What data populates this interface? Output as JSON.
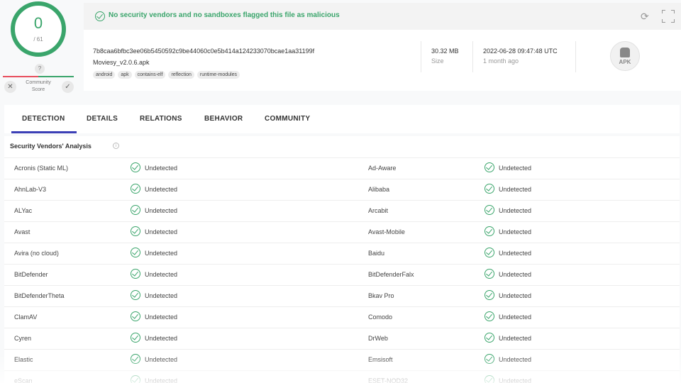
{
  "score": {
    "detections": "0",
    "total": "/ 61",
    "unknown_icon": "?",
    "community_label": "Community Score",
    "ring_color": "#3aa56b"
  },
  "banner": {
    "message": "No security vendors and no sandboxes flagged this file as malicious",
    "accent_color": "#3aa56b",
    "icons": [
      "check-circle-icon",
      "refresh-icon",
      "expand-icon"
    ]
  },
  "file": {
    "hash": "7b8caa6bfbc3ee06b5450592c9be44060c0e5b414a124233070bcae1aa31199f",
    "name": "Moviesy_v2.0.6.apk",
    "tags": [
      "android",
      "apk",
      "contains-elf",
      "reflection",
      "runtime-modules"
    ],
    "size_value": "30.32 MB",
    "size_label": "Size",
    "date_value": "2022-06-28 09:47:48 UTC",
    "date_label": "1 month ago",
    "type_badge": "APK"
  },
  "tabs": [
    {
      "label": "DETECTION",
      "active": true
    },
    {
      "label": "DETAILS",
      "active": false
    },
    {
      "label": "RELATIONS",
      "active": false
    },
    {
      "label": "BEHAVIOR",
      "active": false
    },
    {
      "label": "COMMUNITY",
      "active": false
    }
  ],
  "vendors": {
    "title": "Security Vendors' Analysis",
    "rows": [
      {
        "left": "Acronis (Static ML)",
        "left_status": "Undetected",
        "right": "Ad-Aware",
        "right_status": "Undetected"
      },
      {
        "left": "AhnLab-V3",
        "left_status": "Undetected",
        "right": "Alibaba",
        "right_status": "Undetected"
      },
      {
        "left": "ALYac",
        "left_status": "Undetected",
        "right": "Arcabit",
        "right_status": "Undetected"
      },
      {
        "left": "Avast",
        "left_status": "Undetected",
        "right": "Avast-Mobile",
        "right_status": "Undetected"
      },
      {
        "left": "Avira (no cloud)",
        "left_status": "Undetected",
        "right": "Baidu",
        "right_status": "Undetected"
      },
      {
        "left": "BitDefender",
        "left_status": "Undetected",
        "right": "BitDefenderFalx",
        "right_status": "Undetected"
      },
      {
        "left": "BitDefenderTheta",
        "left_status": "Undetected",
        "right": "Bkav Pro",
        "right_status": "Undetected"
      },
      {
        "left": "ClamAV",
        "left_status": "Undetected",
        "right": "Comodo",
        "right_status": "Undetected"
      },
      {
        "left": "Cyren",
        "left_status": "Undetected",
        "right": "DrWeb",
        "right_status": "Undetected"
      },
      {
        "left": "Elastic",
        "left_status": "Undetected",
        "right": "Emsisoft",
        "right_status": "Undetected"
      },
      {
        "left": "eScan",
        "left_status": "Undetected",
        "right": "ESET-NOD32",
        "right_status": "Undetected"
      }
    ]
  }
}
